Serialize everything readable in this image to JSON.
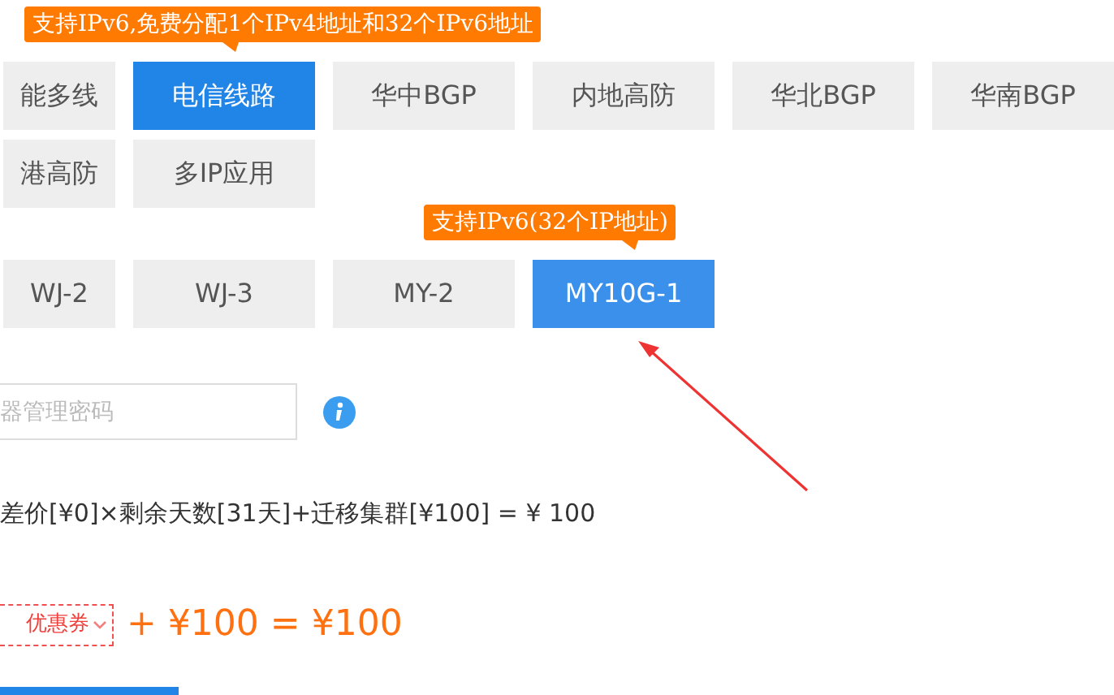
{
  "line_options": [
    {
      "label": "能多线",
      "selected": false
    },
    {
      "label": "电信线路",
      "selected": true,
      "tooltip": "支持IPv6,免费分配1个IPv4地址和32个IPv6地址"
    },
    {
      "label": "华中BGP",
      "selected": false
    },
    {
      "label": "内地高防",
      "selected": false
    },
    {
      "label": "华北BGP",
      "selected": false
    },
    {
      "label": "华南BGP",
      "selected": false
    },
    {
      "label": "港高防",
      "selected": false
    },
    {
      "label": "多IP应用",
      "selected": false
    }
  ],
  "model_options": [
    {
      "label": "WJ-2",
      "selected": false
    },
    {
      "label": "WJ-3",
      "selected": false
    },
    {
      "label": "MY-2",
      "selected": false
    },
    {
      "label": "MY10G-1",
      "selected": true,
      "tooltip": "支持IPv6(32个IP地址)"
    }
  ],
  "password": {
    "placeholder": "器管理密码"
  },
  "formula": "差价[¥0]×剩余天数[31天]+迁移集群[¥100] = ¥ 100",
  "coupon": {
    "label": "优惠券"
  },
  "total": "+ ¥100 = ¥100"
}
